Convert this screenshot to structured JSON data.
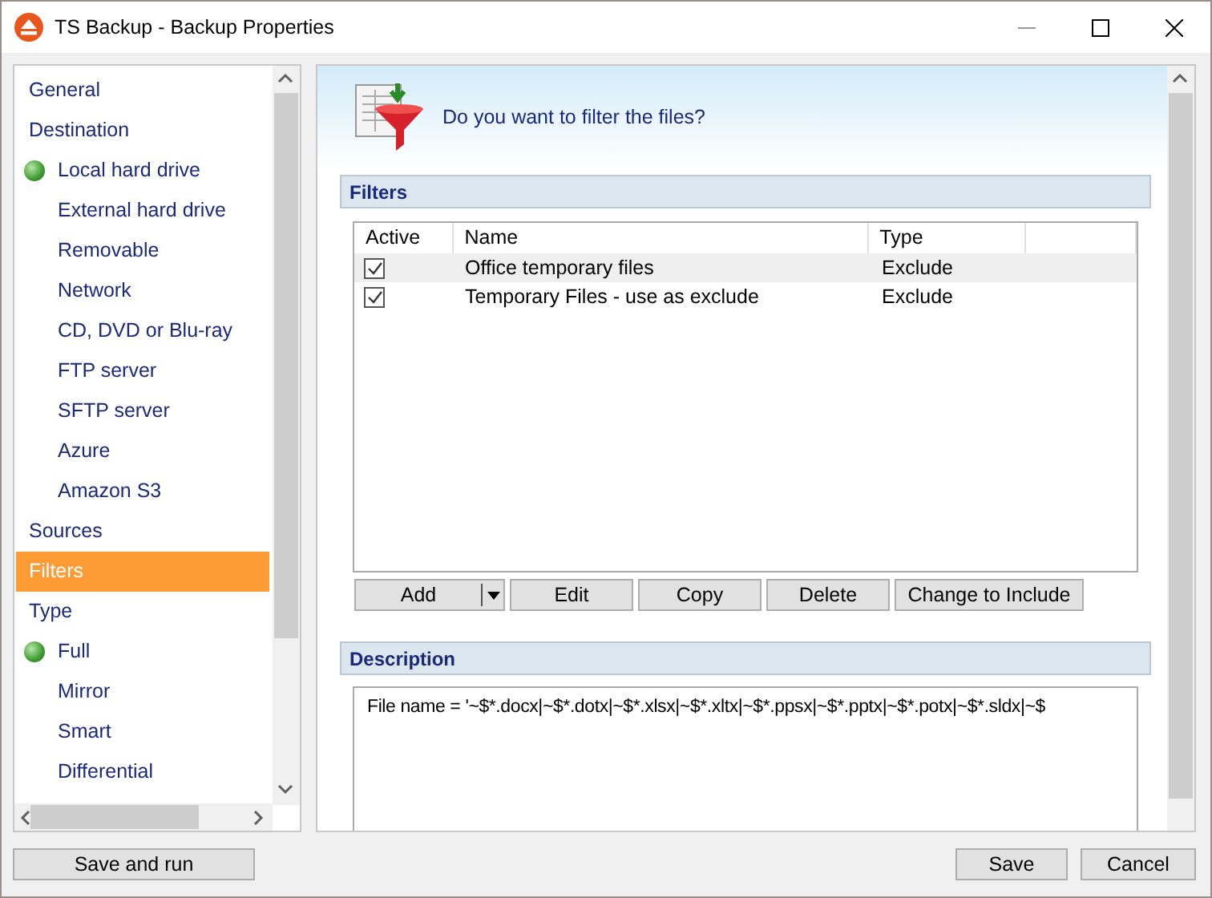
{
  "window": {
    "title": "TS Backup - Backup Properties"
  },
  "sidebar": {
    "items": [
      {
        "label": "General",
        "selected": false
      },
      {
        "label": "Destination",
        "selected": false,
        "children": [
          {
            "label": "Local hard drive",
            "selected": false,
            "active": true
          },
          {
            "label": "External hard drive",
            "selected": false,
            "active": false
          },
          {
            "label": "Removable",
            "selected": false,
            "active": false
          },
          {
            "label": "Network",
            "selected": false,
            "active": false
          },
          {
            "label": "CD, DVD or Blu-ray",
            "selected": false,
            "active": false
          },
          {
            "label": "FTP server",
            "selected": false,
            "active": false
          },
          {
            "label": "SFTP server",
            "selected": false,
            "active": false
          },
          {
            "label": "Azure",
            "selected": false,
            "active": false
          },
          {
            "label": "Amazon S3",
            "selected": false,
            "active": false
          }
        ]
      },
      {
        "label": "Sources",
        "selected": false
      },
      {
        "label": "Filters",
        "selected": true
      },
      {
        "label": "Type",
        "selected": false,
        "children": [
          {
            "label": "Full",
            "selected": false,
            "active": true
          },
          {
            "label": "Mirror",
            "selected": false,
            "active": false
          },
          {
            "label": "Smart",
            "selected": false,
            "active": false
          },
          {
            "label": "Differential",
            "selected": false,
            "active": false
          }
        ]
      }
    ]
  },
  "header": {
    "question": "Do you want to filter the files?"
  },
  "filters": {
    "title": "Filters",
    "columns": [
      "Active",
      "Name",
      "Type"
    ],
    "rows": [
      {
        "checked": true,
        "name": "Office temporary files",
        "type": "Exclude",
        "selected": true
      },
      {
        "checked": true,
        "name": "Temporary Files - use as exclude",
        "type": "Exclude",
        "selected": false
      }
    ],
    "buttons": [
      {
        "label": "Add",
        "kind": "split"
      },
      {
        "label": "Edit",
        "kind": "plain"
      },
      {
        "label": "Copy",
        "kind": "plain"
      },
      {
        "label": "Delete",
        "kind": "plain"
      },
      {
        "label": "Change to Include",
        "kind": "plain"
      }
    ]
  },
  "description": {
    "title": "Description",
    "text": "File name = '~$*.docx|~$*.dotx|~$*.xlsx|~$*.xltx|~$*.ppsx|~$*.pptx|~$*.potx|~$*.sldx|~$"
  },
  "footer": {
    "left_buttons": [
      "Save and run"
    ],
    "right_buttons": [
      "Save",
      "Cancel"
    ]
  }
}
